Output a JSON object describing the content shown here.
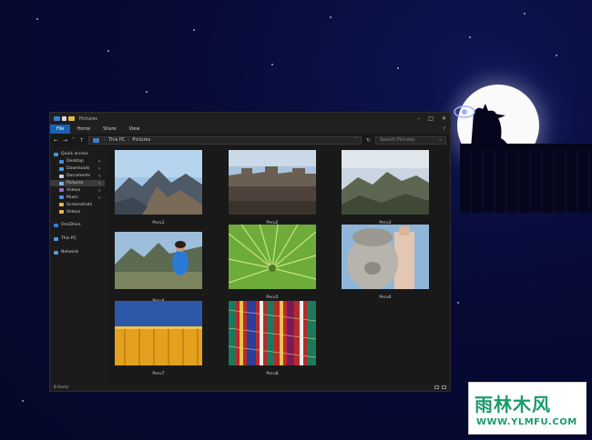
{
  "window": {
    "title": "Pictures"
  },
  "ribbon": {
    "tabs": [
      "File",
      "Home",
      "Share",
      "View"
    ],
    "help": "?"
  },
  "address": {
    "path": [
      "This PC",
      "Pictures"
    ],
    "search_placeholder": "Search Pictures"
  },
  "nav": {
    "quick_access": "Quick access",
    "items": [
      "Desktop",
      "Downloads",
      "Documents",
      "Pictures",
      "Videos",
      "Music",
      "Screenshots",
      "Videos"
    ],
    "onedrive": "OneDrive",
    "this_pc": "This PC",
    "network": "Network"
  },
  "files": [
    "Peru1",
    "Peru2",
    "Peru3",
    "Peru4",
    "Peru5",
    "Peru6",
    "Peru7",
    "Peru8"
  ],
  "status": {
    "count": "8 items"
  },
  "watermark": {
    "text": "雨林木风",
    "url": "WWW.YLMFU.COM"
  },
  "colors": {
    "accent": "#1763b3",
    "background": "#070a35",
    "window": "#191919",
    "watermark": "#1a9b6b"
  }
}
